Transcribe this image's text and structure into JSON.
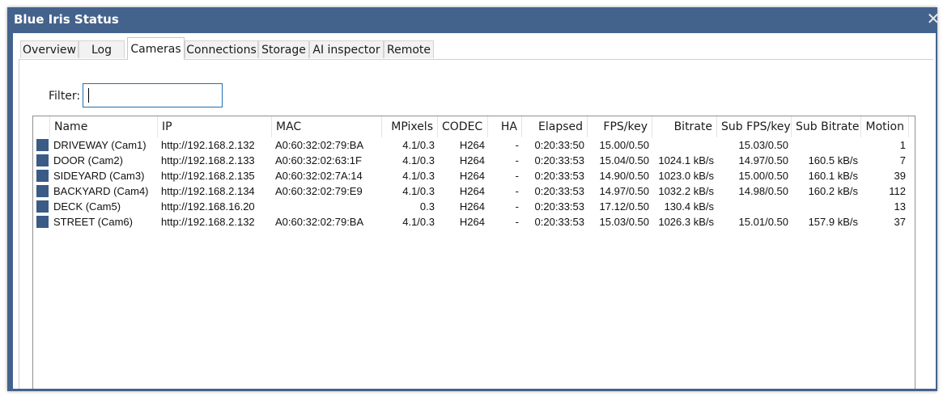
{
  "window": {
    "title": "Blue Iris Status",
    "close_glyph": "✕"
  },
  "tabs": [
    "Overview",
    "Log",
    "Cameras",
    "Connections",
    "Storage",
    "AI inspector",
    "Remote"
  ],
  "active_tab": "Cameras",
  "filter": {
    "label": "Filter:",
    "value": ""
  },
  "columns": [
    "Name",
    "IP",
    "MAC",
    "MPixels",
    "CODEC",
    "HA",
    "Elapsed",
    "FPS/key",
    "Bitrate",
    "Sub FPS/key",
    "Sub Bitrate",
    "Motion"
  ],
  "swatch_color": "#3b5b87",
  "rows": [
    {
      "name": "DRIVEWAY (Cam1)",
      "ip": "http://192.168.2.132",
      "mac": "A0:60:32:02:79:BA",
      "mpixels": "4.1/0.3",
      "codec": "H264",
      "ha": "-",
      "elapsed": "0:20:33:50",
      "fps": "15.00/0.50",
      "bitrate": "",
      "subfps": "15.03/0.50",
      "subbitrate": "",
      "motion": "1"
    },
    {
      "name": "DOOR (Cam2)",
      "ip": "http://192.168.2.133",
      "mac": "A0:60:32:02:63:1F",
      "mpixels": "4.1/0.3",
      "codec": "H264",
      "ha": "-",
      "elapsed": "0:20:33:53",
      "fps": "15.04/0.50",
      "bitrate": "1024.1 kB/s",
      "subfps": "14.97/0.50",
      "subbitrate": "160.5 kB/s",
      "motion": "7"
    },
    {
      "name": "SIDEYARD (Cam3)",
      "ip": "http://192.168.2.135",
      "mac": "A0:60:32:02:7A:14",
      "mpixels": "4.1/0.3",
      "codec": "H264",
      "ha": "-",
      "elapsed": "0:20:33:53",
      "fps": "14.90/0.50",
      "bitrate": "1023.0 kB/s",
      "subfps": "15.00/0.50",
      "subbitrate": "160.1 kB/s",
      "motion": "39"
    },
    {
      "name": "BACKYARD (Cam4)",
      "ip": "http://192.168.2.134",
      "mac": "A0:60:32:02:79:E9",
      "mpixels": "4.1/0.3",
      "codec": "H264",
      "ha": "-",
      "elapsed": "0:20:33:53",
      "fps": "14.97/0.50",
      "bitrate": "1032.2 kB/s",
      "subfps": "14.98/0.50",
      "subbitrate": "160.2 kB/s",
      "motion": "112"
    },
    {
      "name": "DECK (Cam5)",
      "ip": "http://192.168.16.20",
      "mac": "",
      "mpixels": "0.3",
      "codec": "H264",
      "ha": "-",
      "elapsed": "0:20:33:53",
      "fps": "17.12/0.50",
      "bitrate": "130.4 kB/s",
      "subfps": "",
      "subbitrate": "",
      "motion": "13"
    },
    {
      "name": "STREET (Cam6)",
      "ip": "http://192.168.2.132",
      "mac": "A0:60:32:02:79:BA",
      "mpixels": "4.1/0.3",
      "codec": "H264",
      "ha": "-",
      "elapsed": "0:20:33:53",
      "fps": "15.03/0.50",
      "bitrate": "1026.3 kB/s",
      "subfps": "15.01/0.50",
      "subbitrate": "157.9 kB/s",
      "motion": "37"
    }
  ]
}
